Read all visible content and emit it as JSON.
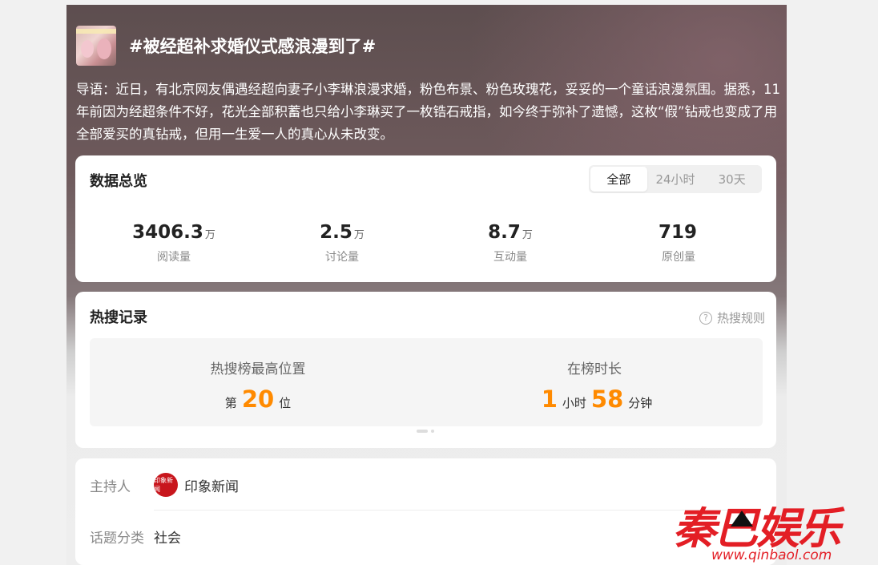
{
  "header": {
    "title": "#被经超补求婚仪式感浪漫到了#"
  },
  "intro": "导语：近日，有北京网友偶遇经超向妻子小李琳浪漫求婚，粉色布景、粉色玫瑰花，妥妥的一个童话浪漫氛围。据悉，11年前因为经超条件不好，花光全部积蓄也只给小李琳买了一枚锆石戒指，如今终于弥补了遗憾，这枚“假”钻戒也变成了用全部爱买的真钻戒，但用一生爱一人的真心从未改变。",
  "overview": {
    "title": "数据总览",
    "tabs": [
      "全部",
      "24小时",
      "30天"
    ],
    "stats": [
      {
        "value": "3406.3",
        "unit": "万",
        "label": "阅读量"
      },
      {
        "value": "2.5",
        "unit": "万",
        "label": "讨论量"
      },
      {
        "value": "8.7",
        "unit": "万",
        "label": "互动量"
      },
      {
        "value": "719",
        "unit": "",
        "label": "原创量"
      }
    ]
  },
  "hot": {
    "title": "热搜记录",
    "rules_label": "热搜规则",
    "rank_label": "热搜榜最高位置",
    "rank_prefix": "第",
    "rank_value": "20",
    "rank_suffix": "位",
    "duration_label": "在榜时长",
    "hours_value": "1",
    "hours_unit": "小时",
    "minutes_value": "58",
    "minutes_unit": "分钟"
  },
  "info": {
    "host_key": "主持人",
    "host_name": "印象新闻",
    "host_logo_text": "印象新闻",
    "category_key": "话题分类",
    "category_value": "社会"
  },
  "watermark": {
    "text": "秦巴娱乐",
    "url": "www.qinbaol.com"
  }
}
